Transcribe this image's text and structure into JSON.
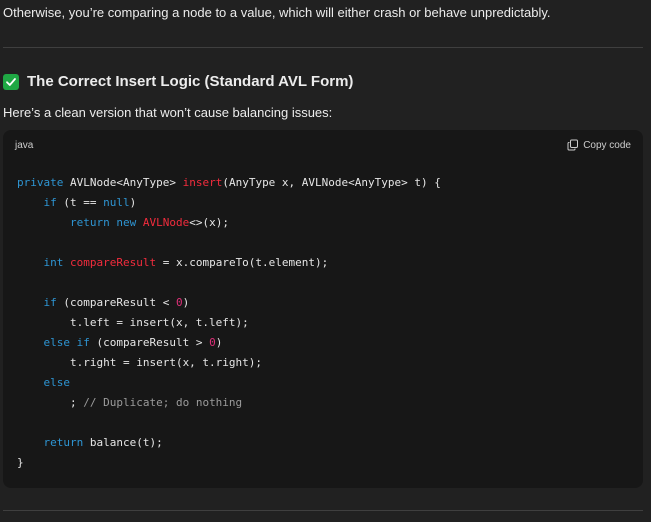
{
  "intro_text": "Otherwise, you’re comparing a node to a value, which will either crash or behave unpredictably.",
  "heading": {
    "icon": "check-mark-icon",
    "text": "The Correct Insert Logic (Standard AVL Form)"
  },
  "subtext": "Here’s a clean version that won’t cause balancing issues:",
  "code_block": {
    "language": "java",
    "copy_label": "Copy code",
    "lines": [
      [
        {
          "t": "private",
          "c": "kw"
        },
        {
          "t": " AVLNode<AnyType> ",
          "c": ""
        },
        {
          "t": "insert",
          "c": "fn"
        },
        {
          "t": "(AnyType x, AVLNode<AnyType> t) {",
          "c": ""
        }
      ],
      [
        {
          "t": "    ",
          "c": ""
        },
        {
          "t": "if",
          "c": "kw"
        },
        {
          "t": " (t == ",
          "c": ""
        },
        {
          "t": "null",
          "c": "kw"
        },
        {
          "t": ")",
          "c": ""
        }
      ],
      [
        {
          "t": "        ",
          "c": ""
        },
        {
          "t": "return",
          "c": "kw"
        },
        {
          "t": " ",
          "c": ""
        },
        {
          "t": "new",
          "c": "kw"
        },
        {
          "t": " ",
          "c": ""
        },
        {
          "t": "AVLNode",
          "c": "fn"
        },
        {
          "t": "<>(x);",
          "c": ""
        }
      ],
      [
        {
          "t": "",
          "c": ""
        }
      ],
      [
        {
          "t": "    ",
          "c": ""
        },
        {
          "t": "int",
          "c": "kw"
        },
        {
          "t": " ",
          "c": ""
        },
        {
          "t": "compareResult",
          "c": "fn"
        },
        {
          "t": " = x.compareTo(t.element);",
          "c": ""
        }
      ],
      [
        {
          "t": "",
          "c": ""
        }
      ],
      [
        {
          "t": "    ",
          "c": ""
        },
        {
          "t": "if",
          "c": "kw"
        },
        {
          "t": " (compareResult < ",
          "c": ""
        },
        {
          "t": "0",
          "c": "num"
        },
        {
          "t": ")",
          "c": ""
        }
      ],
      [
        {
          "t": "        t.left = insert(x, t.left);",
          "c": ""
        }
      ],
      [
        {
          "t": "    ",
          "c": ""
        },
        {
          "t": "else",
          "c": "kw"
        },
        {
          "t": " ",
          "c": ""
        },
        {
          "t": "if",
          "c": "kw"
        },
        {
          "t": " (compareResult > ",
          "c": ""
        },
        {
          "t": "0",
          "c": "num"
        },
        {
          "t": ")",
          "c": ""
        }
      ],
      [
        {
          "t": "        t.right = insert(x, t.right);",
          "c": ""
        }
      ],
      [
        {
          "t": "    ",
          "c": ""
        },
        {
          "t": "else",
          "c": "kw"
        }
      ],
      [
        {
          "t": "        ; ",
          "c": ""
        },
        {
          "t": "// Duplicate; do nothing",
          "c": "cm"
        }
      ],
      [
        {
          "t": "",
          "c": ""
        }
      ],
      [
        {
          "t": "    ",
          "c": ""
        },
        {
          "t": "return",
          "c": "kw"
        },
        {
          "t": " balance(t);",
          "c": ""
        }
      ],
      [
        {
          "t": "}",
          "c": ""
        }
      ]
    ]
  }
}
